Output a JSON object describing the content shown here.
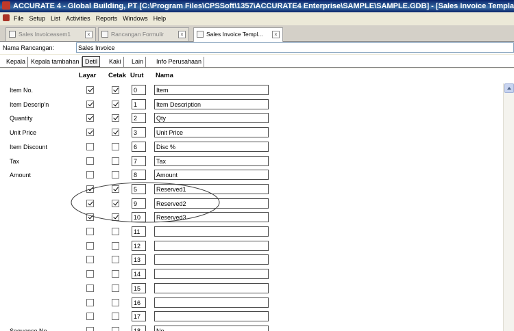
{
  "window": {
    "title": "ACCURATE 4 - Global Building, PT  [C:\\Program Files\\CPSSoft\\1357\\ACCURATE4 Enterprise\\SAMPLE\\SAMPLE.GDB] - [Sales Invoice Template fiel"
  },
  "menu": [
    "File",
    "Setup",
    "List",
    "Activities",
    "Reports",
    "Windows",
    "Help"
  ],
  "doc_tabs": [
    {
      "label": "Sales Invoiceasem1"
    },
    {
      "label": "Rancangan Formulir"
    },
    {
      "label": "Sales Invoice Templ..."
    }
  ],
  "form": {
    "name_label": "Nama Rancangan:",
    "name_value": "Sales Invoice"
  },
  "sub_tabs": [
    "Kepala",
    "Kepala tambahan",
    "Detil",
    "Kaki",
    "Lain",
    "Info Perusahaan"
  ],
  "columns": {
    "layar": "Layar",
    "cetak": "Cetak",
    "urut": "Urut",
    "nama": "Nama"
  },
  "rows": [
    {
      "label": "Item No.",
      "layar": true,
      "cetak": true,
      "urut": "0",
      "nama": "Item"
    },
    {
      "label": "Item Descrip'n",
      "layar": true,
      "cetak": true,
      "urut": "1",
      "nama": "Item Description"
    },
    {
      "label": "Quantity",
      "layar": true,
      "cetak": true,
      "urut": "2",
      "nama": "Qty"
    },
    {
      "label": "Unit Price",
      "layar": true,
      "cetak": true,
      "urut": "3",
      "nama": "Unit Price"
    },
    {
      "label": "Item Discount",
      "layar": false,
      "cetak": false,
      "urut": "6",
      "nama": "Disc %"
    },
    {
      "label": "Tax",
      "layar": false,
      "cetak": false,
      "urut": "7",
      "nama": "Tax"
    },
    {
      "label": "Amount",
      "layar": false,
      "cetak": false,
      "urut": "8",
      "nama": "Amount"
    },
    {
      "label": "",
      "layar": true,
      "cetak": true,
      "urut": "5",
      "nama": "Reserved1"
    },
    {
      "label": "",
      "layar": true,
      "cetak": true,
      "urut": "9",
      "nama": "Reserved2"
    },
    {
      "label": "",
      "layar": true,
      "cetak": true,
      "urut": "10",
      "nama": "Reserved3"
    },
    {
      "label": "",
      "layar": false,
      "cetak": false,
      "urut": "11",
      "nama": ""
    },
    {
      "label": "",
      "layar": false,
      "cetak": false,
      "urut": "12",
      "nama": ""
    },
    {
      "label": "",
      "layar": false,
      "cetak": false,
      "urut": "13",
      "nama": ""
    },
    {
      "label": "",
      "layar": false,
      "cetak": false,
      "urut": "14",
      "nama": ""
    },
    {
      "label": "",
      "layar": false,
      "cetak": false,
      "urut": "15",
      "nama": ""
    },
    {
      "label": "",
      "layar": false,
      "cetak": false,
      "urut": "16",
      "nama": ""
    },
    {
      "label": "",
      "layar": false,
      "cetak": false,
      "urut": "17",
      "nama": ""
    },
    {
      "label": "Sequence No.",
      "layar": false,
      "cetak": false,
      "urut": "18",
      "nama": "No"
    }
  ]
}
